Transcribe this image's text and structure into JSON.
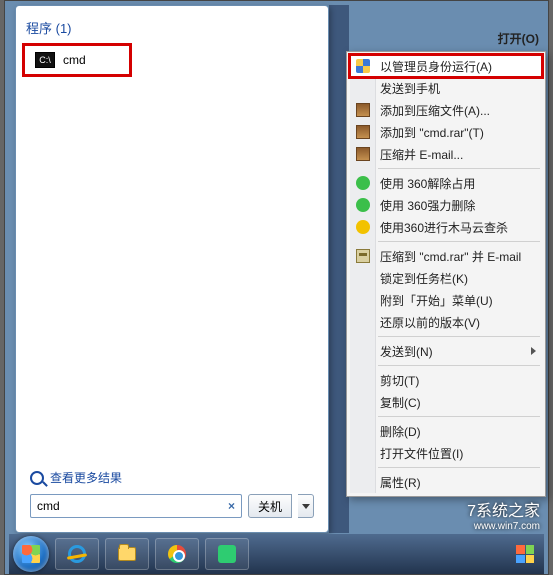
{
  "startPanel": {
    "category": "程序 (1)",
    "result": {
      "icon": "cmd-icon",
      "label": "cmd"
    },
    "seeMore": "查看更多结果",
    "search": {
      "value": "cmd",
      "clear": "×"
    },
    "shutdown": {
      "label": "关机"
    }
  },
  "contextMenu": {
    "heading": "打开(O)",
    "items": [
      {
        "icon": "shield",
        "label": "以管理员身份运行(A)",
        "highlight": true
      },
      {
        "icon": "none",
        "label": "发送到手机"
      },
      {
        "icon": "rar",
        "label": "添加到压缩文件(A)..."
      },
      {
        "icon": "rar",
        "label": "添加到 \"cmd.rar\"(T)"
      },
      {
        "icon": "rar",
        "label": "压缩并 E-mail..."
      },
      {
        "sep": true
      },
      {
        "icon": "360g",
        "label": "使用 360解除占用"
      },
      {
        "icon": "360g",
        "label": "使用 360强力删除"
      },
      {
        "icon": "360y",
        "label": "使用360进行木马云查杀"
      },
      {
        "sep": true
      },
      {
        "icon": "rars",
        "label": "压缩到 \"cmd.rar\" 并 E-mail"
      },
      {
        "icon": "none",
        "label": "锁定到任务栏(K)"
      },
      {
        "icon": "none",
        "label": "附到「开始」菜单(U)"
      },
      {
        "icon": "none",
        "label": "还原以前的版本(V)"
      },
      {
        "sep": true
      },
      {
        "icon": "none",
        "label": "发送到(N)",
        "submenu": true
      },
      {
        "sep": true
      },
      {
        "icon": "none",
        "label": "剪切(T)"
      },
      {
        "icon": "none",
        "label": "复制(C)"
      },
      {
        "sep": true
      },
      {
        "icon": "none",
        "label": "删除(D)"
      },
      {
        "icon": "none",
        "label": "打开文件位置(I)"
      },
      {
        "sep": true
      },
      {
        "icon": "none",
        "label": "属性(R)"
      }
    ]
  },
  "watermark": {
    "line1": "7系统之家",
    "line2": "www.win7.com"
  }
}
